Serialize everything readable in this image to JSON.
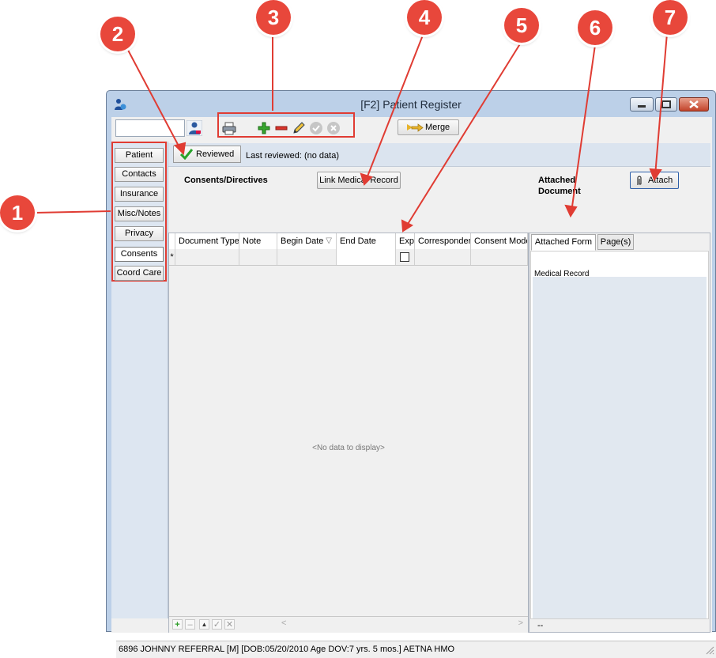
{
  "window": {
    "title": "[F2] Patient Register",
    "icon": "patient-register-icon"
  },
  "toolbar": {
    "search_value": "",
    "merge_label": "Merge",
    "icons": [
      "user-search-icon",
      "printer-icon",
      "plus-icon",
      "minus-icon",
      "pencil-icon",
      "check-circle-icon",
      "cancel-circle-icon",
      "merge-arrow-icon"
    ]
  },
  "nav": {
    "items": [
      {
        "label": "Patient"
      },
      {
        "label": "Contacts"
      },
      {
        "label": "Insurance"
      },
      {
        "label": "Misc/Notes"
      },
      {
        "label": "Privacy"
      },
      {
        "label": "Consents",
        "active": true
      },
      {
        "label": "Coord Care"
      }
    ]
  },
  "review": {
    "button_label": "Reviewed",
    "last_reviewed": "Last reviewed: (no data)"
  },
  "consents": {
    "section_label": "Consents/Directives",
    "link_button": "Link Medical Record"
  },
  "attached": {
    "section_label_line1": "Attached",
    "section_label_line2": "Document",
    "attach_button": "Attach"
  },
  "grid": {
    "columns": [
      "Document Type",
      "Note",
      "Begin Date",
      "End Date",
      "Exp",
      "Corresponder",
      "Consent Mode"
    ],
    "new_row_marker": "*",
    "no_data": "<No data to display>",
    "footer_buttons": [
      "+",
      "–",
      "▲",
      "✓",
      "✕"
    ]
  },
  "right_panel": {
    "tabs": [
      "Attached Form",
      "Page(s)"
    ],
    "medical_record_label": "Medical Record",
    "footer_text": "--"
  },
  "status": {
    "text": "6896 JOHNNY REFERRAL [M] [DOB:05/20/2010  Age DOV:7 yrs. 5 mos.] AETNA HMO"
  },
  "callouts": [
    "1",
    "2",
    "3",
    "4",
    "5",
    "6",
    "7"
  ],
  "colors": {
    "callout": "#e8473b",
    "highlight": "#e03c33",
    "titlebar": "#bcd0e8"
  }
}
